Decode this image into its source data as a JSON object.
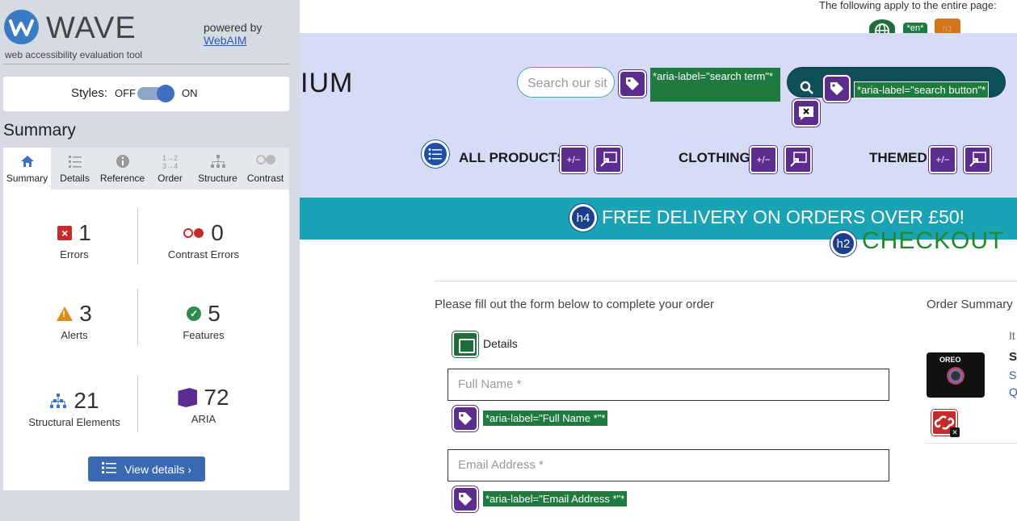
{
  "wave": {
    "logo": "WAVE",
    "tagline": "web accessibility evaluation tool",
    "powered_by": "powered by",
    "webaim": "WebAIM",
    "styles_label": "Styles:",
    "styles_off": "OFF",
    "styles_on": "ON",
    "summary_title": "Summary",
    "tabs": [
      {
        "label": "Summary",
        "icon": "home-icon"
      },
      {
        "label": "Details",
        "icon": "list-icon"
      },
      {
        "label": "Reference",
        "icon": "info-icon"
      },
      {
        "label": "Order",
        "icon": "order-icon"
      },
      {
        "label": "Structure",
        "icon": "structure-icon"
      },
      {
        "label": "Contrast",
        "icon": "contrast-icon"
      }
    ],
    "stats": {
      "errors": {
        "count": "1",
        "label": "Errors"
      },
      "contrast": {
        "count": "0",
        "label": "Contrast Errors"
      },
      "alerts": {
        "count": "3",
        "label": "Alerts"
      },
      "features": {
        "count": "5",
        "label": "Features"
      },
      "structural": {
        "count": "21",
        "label": "Structural Elements"
      },
      "aria": {
        "count": "72",
        "label": "ARIA"
      }
    },
    "view_details": "View details ›"
  },
  "page": {
    "top_note": "The following apply to the entire page:",
    "lang_badge": "*en*",
    "h1_badge": "h1",
    "brand": "IUM",
    "search_placeholder": "Search our sit",
    "search_aria": "*aria-label=\"search term\"*",
    "search_button_aria": "*aria-label=\"search button\"*",
    "nav": [
      "ALL PRODUCTS",
      "CLOTHING",
      "THEMED"
    ],
    "expand_badge": "+/−",
    "banner_badge": "h4",
    "banner": "FREE DELIVERY ON ORDERS OVER £50!",
    "checkout_badge": "h2",
    "checkout": "CHECKOUT",
    "form_intro": "Please fill out the form below to complete your order",
    "order_summary": "Order Summary",
    "details_label": "Details",
    "full_name_placeholder": "Full Name *",
    "full_name_aria": "*aria-label=\"Full Name *\"*",
    "email_placeholder": "Email Address *",
    "email_aria": "*aria-label=\"Email Address *\"*",
    "product_label": "OREO",
    "side_texts": [
      "It",
      "S",
      "Si",
      "Q"
    ]
  },
  "colors": {
    "aria_purple": "#5b2d8e",
    "feature_green": "#1e7a3e",
    "banner_teal": "#1aa3b5",
    "header_bg": "#d6dcf5",
    "checkout_green": "#1e8a2e"
  }
}
